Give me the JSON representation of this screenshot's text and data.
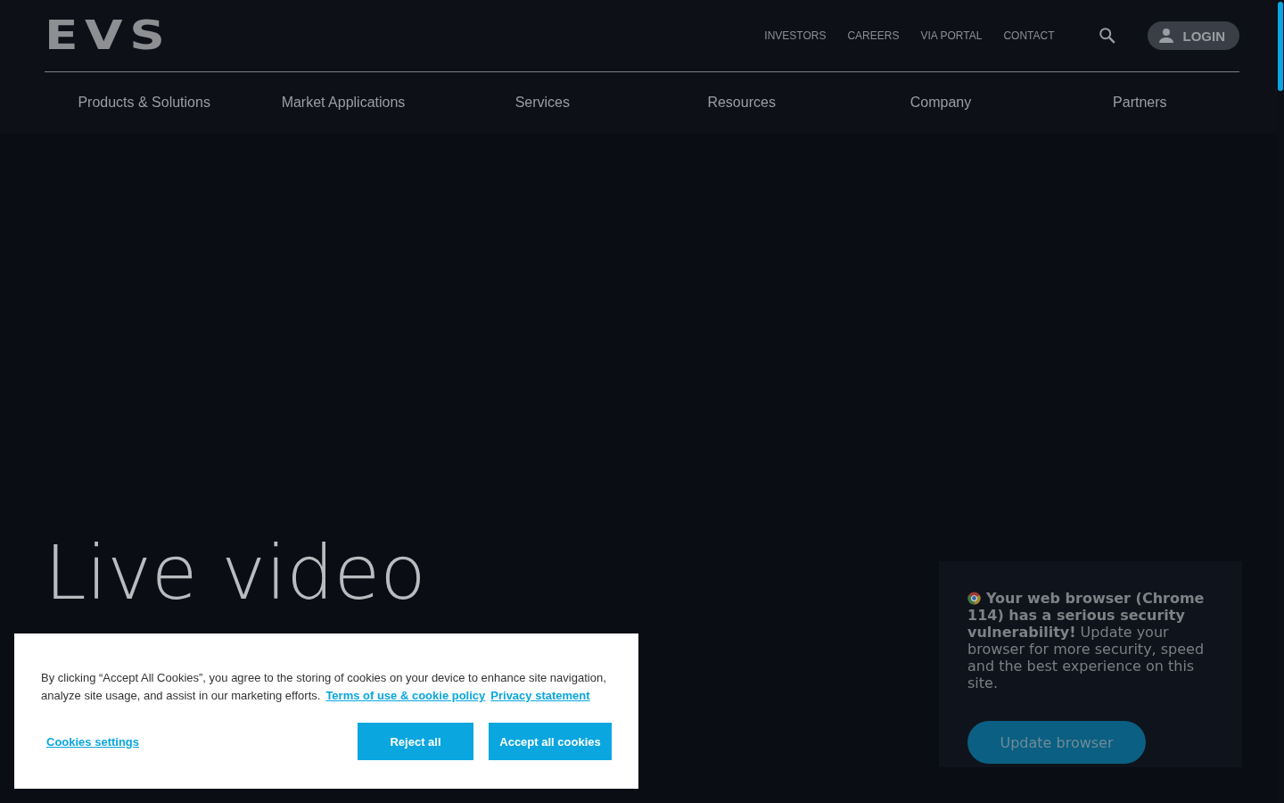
{
  "header": {
    "logo": "EVS",
    "utility_links": [
      "INVESTORS",
      "CAREERS",
      "VIA PORTAL",
      "CONTACT"
    ],
    "login": "LOGIN",
    "nav": [
      "Products & Solutions",
      "Market Applications",
      "Services",
      "Resources",
      "Company",
      "Partners"
    ]
  },
  "hero": {
    "heading": "Live video"
  },
  "cookie_banner": {
    "text": "By clicking “Accept All Cookies”, you agree to the storing of cookies on your device to enhance site navigation, analyze site usage, and assist in our marketing efforts.",
    "links": [
      "Terms of use & cookie policy",
      "Privacy statement"
    ],
    "settings": "Cookies settings",
    "buttons": [
      "Reject all",
      "Accept all cookies"
    ]
  },
  "browser_notice": {
    "message": "**Your web browser (Chrome 114) has a serious security vulnerability!** Update your browser for more security, speed and the best experience on this site.",
    "button": "Update browser"
  }
}
